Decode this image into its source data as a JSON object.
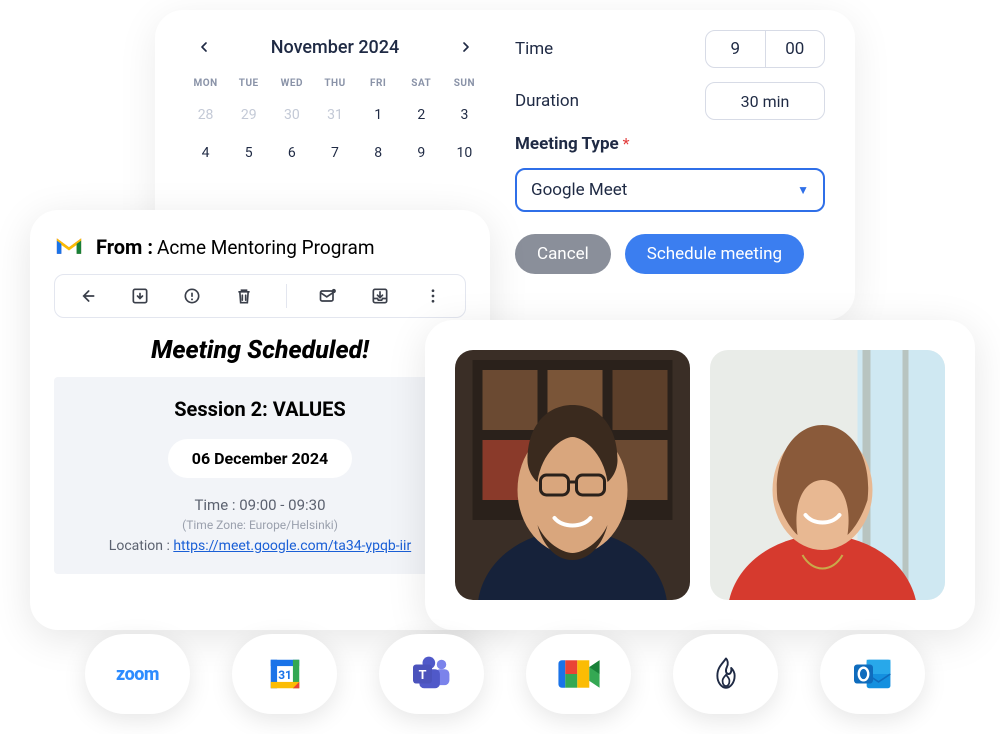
{
  "calendar": {
    "month_label": "November 2024",
    "dow": [
      "MON",
      "TUE",
      "WED",
      "THU",
      "FRI",
      "SAT",
      "SUN"
    ],
    "days": [
      {
        "n": "28",
        "muted": true
      },
      {
        "n": "29",
        "muted": true
      },
      {
        "n": "30",
        "muted": true
      },
      {
        "n": "31",
        "muted": true
      },
      {
        "n": "1"
      },
      {
        "n": "2"
      },
      {
        "n": "3"
      },
      {
        "n": "4"
      },
      {
        "n": "5"
      },
      {
        "n": "6"
      },
      {
        "n": "7"
      },
      {
        "n": "8"
      },
      {
        "n": "9"
      },
      {
        "n": "10"
      }
    ]
  },
  "settings": {
    "time_label": "Time",
    "time_hour": "9",
    "time_min": "00",
    "duration_label": "Duration",
    "duration_value": "30 min",
    "meeting_type_label": "Meeting Type",
    "required_marker": "*",
    "meeting_type_value": "Google Meet",
    "cancel_label": "Cancel",
    "schedule_label": "Schedule meeting"
  },
  "email": {
    "from_prefix": "From :",
    "from_value": "Acme Mentoring Program",
    "scheduled_title": "Meeting Scheduled!",
    "session_line": "Session 2:  VALUES",
    "date_pill": "06 December 2024",
    "time_line": "Time : 09:00 - 09:30",
    "tz_line": "(Time Zone: Europe/Helsinki)",
    "location_prefix": "Location :",
    "location_link": "https://meet.google.com/ta34-ypqb-iir"
  },
  "video": {
    "tile1_name": "participant-1",
    "tile2_name": "participant-2"
  },
  "integrations": [
    "zoom",
    "google-calendar",
    "ms-teams",
    "google-meet",
    "jira",
    "outlook"
  ]
}
